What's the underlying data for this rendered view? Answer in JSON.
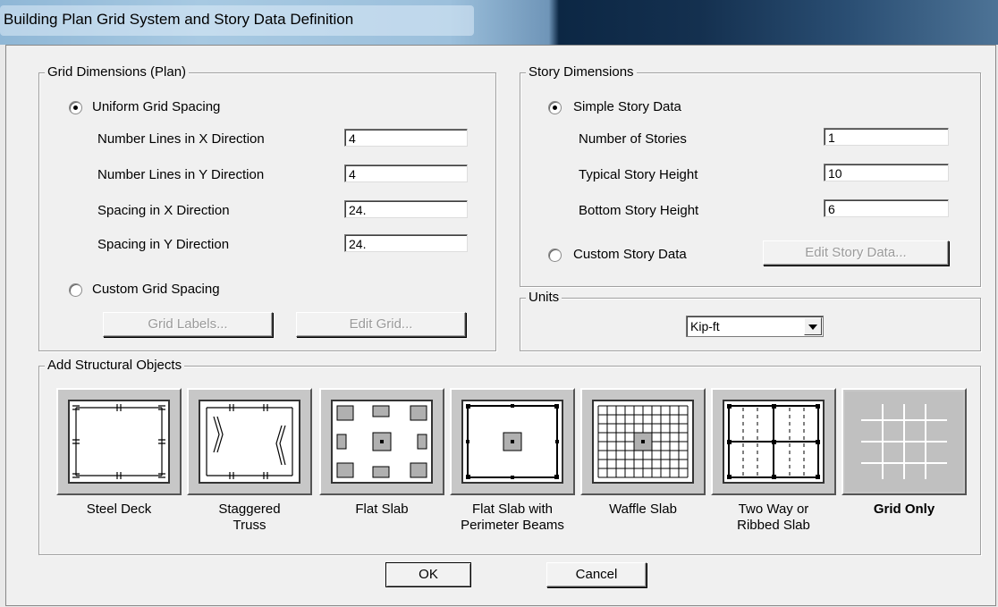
{
  "window": {
    "title": "Building Plan Grid System and Story Data Definition"
  },
  "grid": {
    "legend": "Grid Dimensions (Plan)",
    "uniform_label": "Uniform Grid Spacing",
    "lines_x_label": "Number Lines in X Direction",
    "lines_x_value": "4",
    "lines_y_label": "Number Lines in Y Direction",
    "lines_y_value": "4",
    "spacing_x_label": "Spacing in X Direction",
    "spacing_x_value": "24.",
    "spacing_y_label": "Spacing in Y Direction",
    "spacing_y_value": "24.",
    "custom_label": "Custom Grid Spacing",
    "grid_labels_button": "Grid Labels...",
    "edit_grid_button": "Edit Grid..."
  },
  "story": {
    "legend": "Story Dimensions",
    "simple_label": "Simple Story Data",
    "num_stories_label": "Number of Stories",
    "num_stories_value": "1",
    "typical_height_label": "Typical Story Height",
    "typical_height_value": "10",
    "bottom_height_label": "Bottom Story Height",
    "bottom_height_value": "6",
    "custom_label": "Custom Story Data",
    "edit_story_button": "Edit Story Data..."
  },
  "units": {
    "legend": "Units",
    "selected": "Kip-ft"
  },
  "objects": {
    "legend": "Add Structural Objects",
    "items": [
      {
        "label": "Steel Deck",
        "icon": "steel-deck-icon"
      },
      {
        "label": "Staggered\nTruss",
        "icon": "staggered-truss-icon"
      },
      {
        "label": "Flat Slab",
        "icon": "flat-slab-icon"
      },
      {
        "label": "Flat Slab with\nPerimeter Beams",
        "icon": "flat-slab-perimeter-beams-icon"
      },
      {
        "label": "Waffle Slab",
        "icon": "waffle-slab-icon"
      },
      {
        "label": "Two Way or\nRibbed Slab",
        "icon": "two-way-ribbed-slab-icon"
      },
      {
        "label": "Grid Only",
        "icon": "grid-only-icon"
      }
    ]
  },
  "buttons": {
    "ok": "OK",
    "cancel": "Cancel"
  }
}
